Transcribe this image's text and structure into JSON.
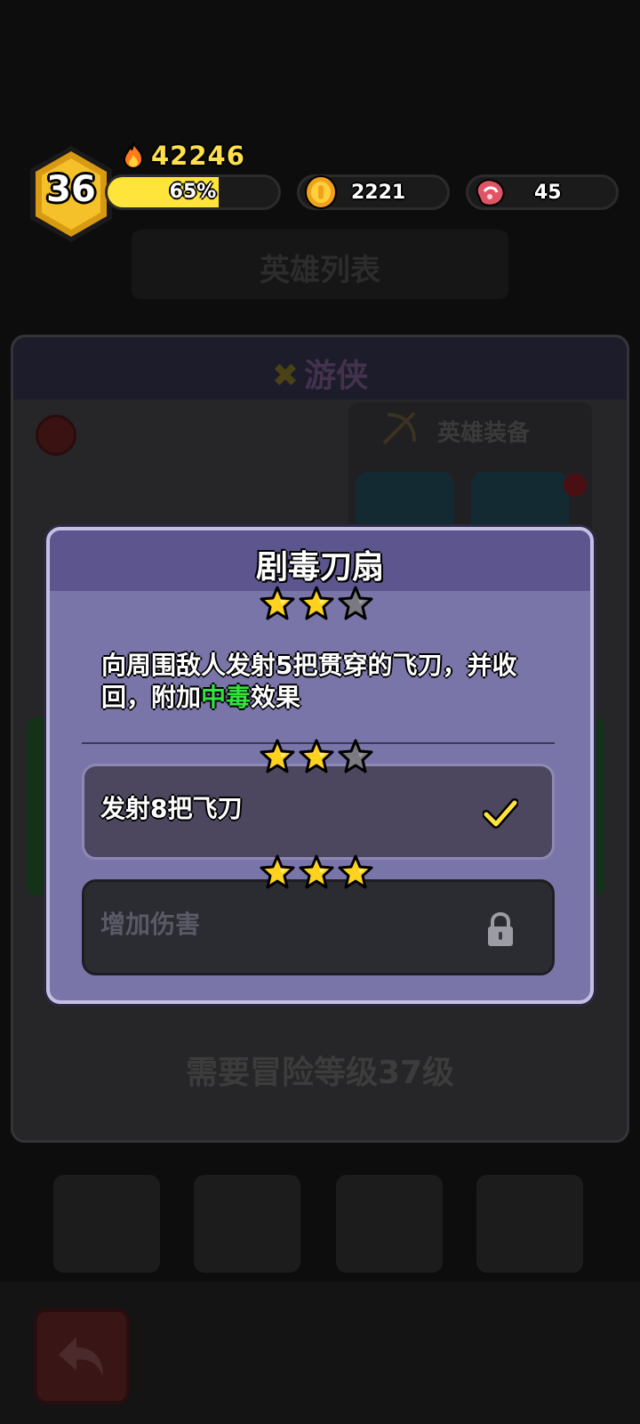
{
  "hud": {
    "level": "36",
    "power": "42246",
    "xp_percent_label": "65%",
    "xp_fraction": 0.65,
    "coins": "2221",
    "meat": "45"
  },
  "background": {
    "list_title": "英雄列表",
    "hero_class": "游侠",
    "equipment_title": "英雄装备",
    "requirement": "需要冒险等级37级"
  },
  "modal": {
    "title": "剧毒刀扇",
    "stars_filled": 2,
    "stars_total": 3,
    "description_before": "向周围敌人发射5把贯穿的飞刀，并收回，附加",
    "description_highlight": "中毒",
    "description_after": "效果",
    "tiers": [
      {
        "label": "发射8把飞刀",
        "stars_filled": 2,
        "status": "unlocked"
      },
      {
        "label": "增加伤害",
        "stars_filled": 3,
        "status": "locked"
      }
    ]
  },
  "colors": {
    "accent_yellow": "#ffe43c",
    "highlight_green": "#33e23f",
    "modal_bg": "#7975a8",
    "modal_header": "#5d568e"
  },
  "icons": [
    "flame-icon",
    "coin-icon",
    "meat-icon",
    "star-icon",
    "check-icon",
    "lock-icon",
    "back-arrow-icon",
    "search-icon",
    "bow-icon"
  ]
}
